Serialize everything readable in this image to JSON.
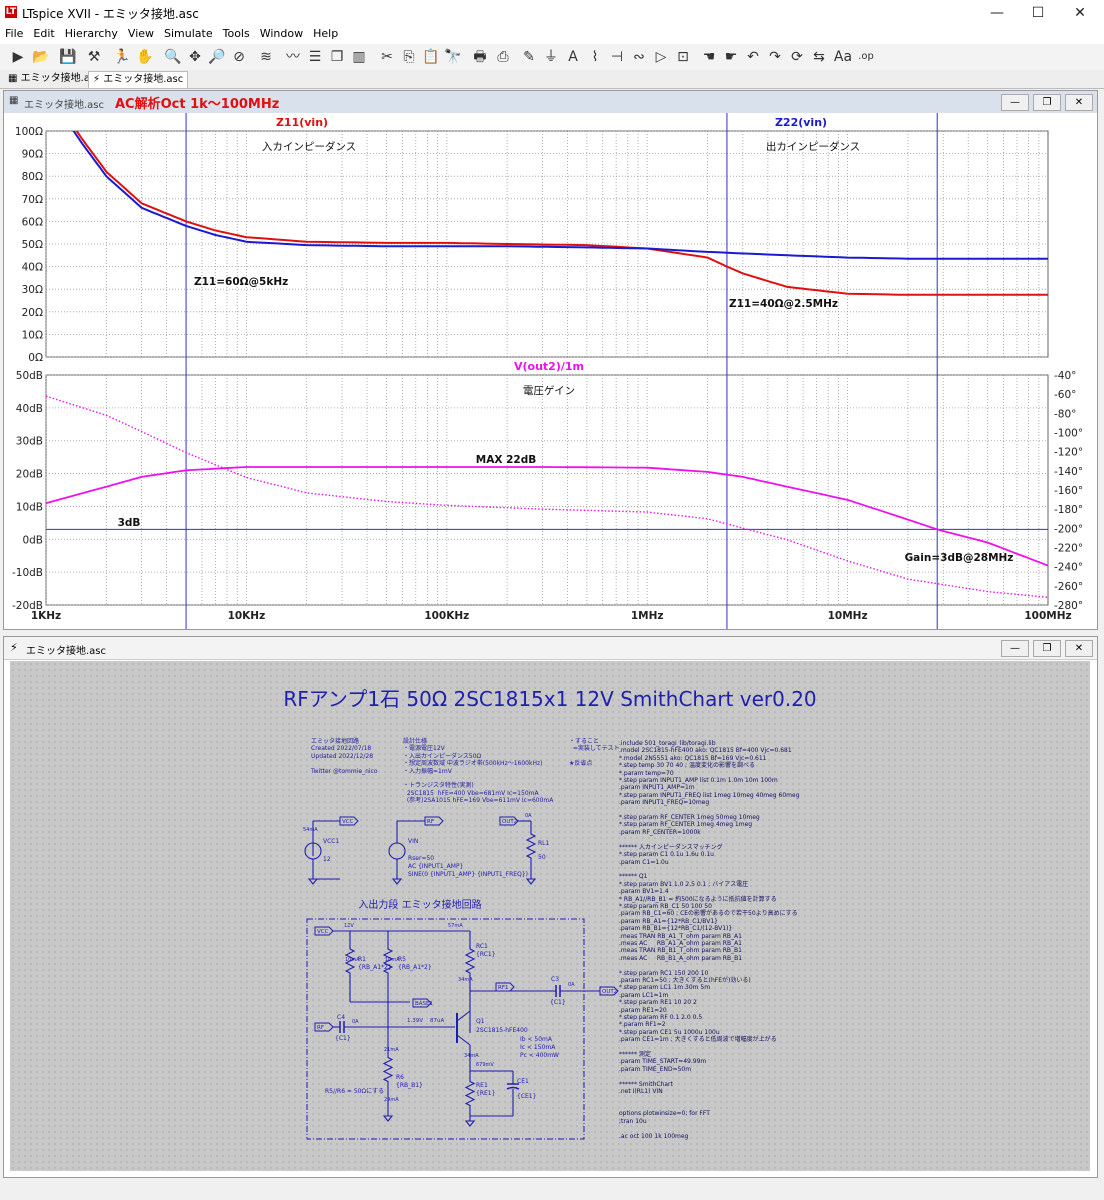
{
  "window": {
    "title": "LTspice XVII - エミッタ接地.asc",
    "logo": "LT",
    "minimize": "—",
    "maximize": "☐",
    "close": "✕"
  },
  "menu": [
    "File",
    "Edit",
    "Hierarchy",
    "View",
    "Simulate",
    "Tools",
    "Window",
    "Help"
  ],
  "tabs": [
    {
      "label": "エミッタ接地.asc",
      "active": false
    },
    {
      "label": "エミッタ接地.asc",
      "active": true
    }
  ],
  "plot_window": {
    "caption": "エミッタ接地.asc",
    "title": "AC解析Oct 1k～100MHz"
  },
  "schematic_window": {
    "caption": "エミッタ接地.asc"
  },
  "chart_data": [
    {
      "type": "line",
      "title": "",
      "series": [
        {
          "name": "Z11(vin)",
          "color": "#e01010",
          "x": [
            1000,
            1500,
            2000,
            3000,
            5000,
            7000,
            10000,
            20000,
            50000,
            100000,
            200000,
            500000,
            1000000,
            2000000,
            2500000,
            3000000,
            5000000,
            10000000,
            20000000,
            100000000
          ],
          "y": [
            120,
            97,
            82,
            68,
            60,
            56,
            53,
            51,
            50.5,
            50.5,
            50,
            49.5,
            48,
            44,
            40,
            37,
            31,
            28,
            27.5,
            27.5
          ]
        },
        {
          "name": "Z22(vin)",
          "color": "#1a1ad0",
          "x": [
            1000,
            1500,
            2000,
            3000,
            5000,
            7000,
            10000,
            20000,
            50000,
            100000,
            200000,
            500000,
            1000000,
            2000000,
            5000000,
            10000000,
            20000000,
            100000000
          ],
          "y": [
            118,
            95,
            80,
            66,
            58,
            54,
            51,
            49.5,
            49,
            49,
            49,
            48.5,
            48,
            46.5,
            45,
            44,
            43.5,
            43.5
          ]
        }
      ],
      "xlim": [
        1000,
        100000000
      ],
      "xscale": "log",
      "ylim": [
        0,
        100
      ],
      "yticks": [
        "0Ω",
        "10Ω",
        "20Ω",
        "30Ω",
        "40Ω",
        "50Ω",
        "60Ω",
        "70Ω",
        "80Ω",
        "90Ω",
        "100Ω"
      ],
      "annotations": [
        "入カインピーダンス",
        "出カインピーダンス",
        "Z11=60Ω@5kHz",
        "Z11=40Ω@2.5MHz"
      ],
      "cursor_x": [
        5000,
        2500000,
        28000000
      ]
    },
    {
      "type": "line",
      "title": "",
      "series": [
        {
          "name": "V(out2)/1m",
          "color": "#ee10ee",
          "style": "solid",
          "x": [
            1000,
            2000,
            3000,
            5000,
            10000,
            30000,
            100000,
            300000,
            1000000,
            2000000,
            3000000,
            5000000,
            10000000,
            20000000,
            28000000,
            50000000,
            100000000
          ],
          "y": [
            11,
            16,
            19,
            21,
            22,
            22,
            22,
            22,
            21.8,
            20.5,
            19,
            16,
            12,
            6,
            3,
            -1,
            -8
          ]
        },
        {
          "name": "V(out2)/1m phase",
          "color": "#ee10ee",
          "style": "dotted",
          "x": [
            1000,
            2000,
            3000,
            5000,
            10000,
            20000,
            50000,
            100000,
            300000,
            1000000,
            2000000,
            5000000,
            10000000,
            20000000,
            50000000,
            100000000
          ],
          "y": [
            -62,
            -82,
            -99,
            -121,
            -147,
            -163,
            -172,
            -176,
            -180,
            -183,
            -190,
            -212,
            -234,
            -253,
            -266,
            -272
          ]
        }
      ],
      "xlim": [
        1000,
        100000000
      ],
      "xscale": "log",
      "ylim": [
        -20,
        50
      ],
      "yticks": [
        "-20dB",
        "-10dB",
        "0dB",
        "10dB",
        "20dB",
        "30dB",
        "40dB",
        "50dB"
      ],
      "y2lim": [
        -280,
        -40
      ],
      "y2ticks": [
        "-280°",
        "-260°",
        "-240°",
        "-220°",
        "-200°",
        "-180°",
        "-160°",
        "-140°",
        "-120°",
        "-100°",
        "-80°",
        "-60°",
        "-40°"
      ],
      "xticks": [
        "1KHz",
        "10KHz",
        "100KHz",
        "1MHz",
        "10MHz",
        "100MHz"
      ],
      "annotations": [
        "電圧ゲイン",
        "MAX 22dB",
        "3dB",
        "Gain=3dB@28MHz"
      ],
      "hline": 3,
      "cursor_x": [
        5000,
        2500000,
        28000000
      ]
    }
  ],
  "schematic": {
    "title": "RFアンプ1石 50Ω 2SC1815x1 12V SmithChart ver0.20",
    "info": [
      "エミッタ接地回路",
      "Created 2022/07/18",
      "Updated 2022/12/28",
      "",
      "Twitter @tommie_nico"
    ],
    "spec": [
      "設計仕様",
      "・電源電圧12V",
      "・入出カインピーダンス50Ω",
      "・想定周波数域 中波ラジオ帯(500kHz～1600kHz)",
      "・入力振幅=1mV",
      "",
      "・トランジスタ特性(実測)",
      "  2SC1815  hFE=400 Vbe=681mV Ic=150mA",
      "  (参考)2SA1015 hFE=169 Vbe=611mV Ic=600mA"
    ],
    "todo": [
      "・すること",
      "  =実装してテスト",
      "",
      "★反省点"
    ],
    "netlist": [
      ".include 501_toragi_lib/toragi.lib",
      ".model 2SC1815-hFE400 ako: QC1815 Bf=400 Vjc=0.681",
      "*.model 2N5551 ako: QC1815 Bf=169 Vjc=0.611",
      "*.step temp 30 70 40 ; 温度変化の影響を調べる",
      "*.param temp=70",
      "*.step param INPUT1_AMP list 0.1m 1.0m 10m 100m",
      ".param INPUT1_AMP=1m",
      "*.step param INPUT1_FREQ list 1meg 10meg 40meg 60meg",
      ".param INPUT1_FREQ=10meg",
      "",
      "*.step param RF_CENTER 1meg 50meg 10meg",
      "*.step param RF_CENTER 1meg 4meg 1meg",
      ".param RF_CENTER=1000k",
      "",
      "****** 入カインピーダンスマッチング",
      "*.step param C1 0.1u 1.6u 0.1u",
      ".param C1=1.0u",
      "",
      "****** Q1",
      "*.step param BV1 1.0 2.5 0.1 ; バイアス電圧",
      ".param BV1=1.4",
      "* RB_A1//RB_B1 = 約500になるように抵抗値を計算する",
      "*.step param RB_C1 50 100 50",
      ".param RB_C1=60 ; CEの影響があるので若干50より高めにする",
      ".param RB_A1={12*RB_C1/BV1}",
      ".param RB_B1={12*RB_C1/(12-BV1)}",
      ".meas TRAN RB_A1_T_ohm param RB_A1",
      ".meas AC     RB_A1_A_ohm param RB_A1",
      ".meas TRAN RB_B1_T_ohm param RB_B1",
      ".meas AC     RB_B1_A_ohm param RB_B1",
      "",
      "*.step param RC1 150 200 10",
      ".param RC1=50 ; 大きくすると(hFEが)効いる)",
      "*.step param LC1 1m 30m 5m",
      ".param LC1=1m",
      "*.step param RE1 10 20 2",
      ".param RE1=20",
      "*.step param RF 0.1 2.0 0.5",
      "*.param RF1=2",
      "*.step param CE1 5u 1000u 100u",
      ".param CE1=1m ; 大きくすると低周波で増幅度が上がる",
      "",
      "****** 測定",
      ".param TIME_START=49.99m",
      ".param TIME_END=50m",
      "",
      "****** SmithChart",
      ".net I(RL1) VIN",
      "",
      "",
      "options plotwinsize=0; for FFT",
      ";tran 10u",
      "",
      ".ac oct 100 1k 100meg"
    ],
    "sources": {
      "vcc_label": "VCC",
      "vcc_value": "12",
      "vcc_name": "VCC1",
      "vcc_current": "54mA",
      "vin_label": "RF",
      "vin_name": "VIN",
      "vin_rser": "Rser=50",
      "vin_ac": "AC {INPUT1_AMP}",
      "vin_sine": "SINE(0 {INPUT1_AMP} {INPUT1_FREQ})",
      "out_label": "OUT2",
      "rl_name": "RL1",
      "rl_value": "50",
      "out_current": "0A"
    },
    "stage": {
      "title": "入出力段  エミッタ接地回路",
      "vcc_label": "VCC",
      "v12": "12V",
      "v57": "57mA",
      "r1": "R1",
      "r1_val": "{RB_A1*2}",
      "r5": "R5",
      "r5_val": "{RB_A1*2}",
      "r1_i": "10mA",
      "r5_i": "10mA",
      "rc1": "RC1",
      "rc1_val": "{RC1}",
      "rc1_i": "34mA",
      "rf1_label": "RF1",
      "c3": "C3",
      "c3_val": "{C1}",
      "out2": "OUT2",
      "out_i": "0A",
      "base_label": "BASE1",
      "rf_label": "RF",
      "c4": "C4",
      "c4_val": "{C1}",
      "c4_i": "0A",
      "vbe": "1.39V",
      "ib": "87uA",
      "q1": "Q1",
      "q1_model": "2SC1815-hFE400",
      "lim1": "Ib < 50mA",
      "lim2": "Ic < 150mA",
      "lim3": "Pc < 400mW",
      "r6": "R6",
      "r6_val": "{RB_B1}",
      "r6_i": "21mA",
      "r6_i2": "29mA",
      "ve": "679mV",
      "re1": "RE1",
      "re1_val": "{RE1}",
      "ce1": "CE1",
      "ce1_val": "{CE1}",
      "ie": "34mA",
      "note": "R5//R6 = 50Ωにする"
    }
  }
}
